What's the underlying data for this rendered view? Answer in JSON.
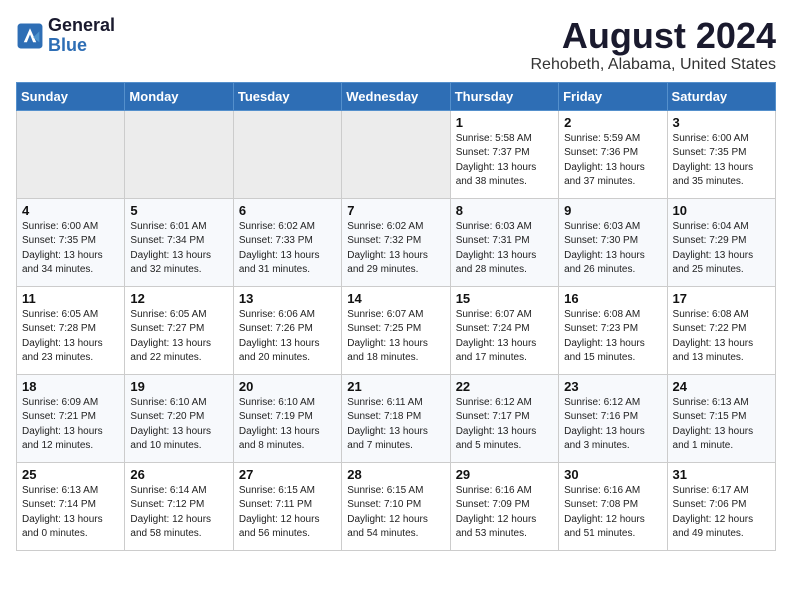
{
  "header": {
    "logo_line1": "General",
    "logo_line2": "Blue",
    "month_year": "August 2024",
    "location": "Rehobeth, Alabama, United States"
  },
  "weekdays": [
    "Sunday",
    "Monday",
    "Tuesday",
    "Wednesday",
    "Thursday",
    "Friday",
    "Saturday"
  ],
  "weeks": [
    [
      {
        "day": "",
        "info": ""
      },
      {
        "day": "",
        "info": ""
      },
      {
        "day": "",
        "info": ""
      },
      {
        "day": "",
        "info": ""
      },
      {
        "day": "1",
        "info": "Sunrise: 5:58 AM\nSunset: 7:37 PM\nDaylight: 13 hours\nand 38 minutes."
      },
      {
        "day": "2",
        "info": "Sunrise: 5:59 AM\nSunset: 7:36 PM\nDaylight: 13 hours\nand 37 minutes."
      },
      {
        "day": "3",
        "info": "Sunrise: 6:00 AM\nSunset: 7:35 PM\nDaylight: 13 hours\nand 35 minutes."
      }
    ],
    [
      {
        "day": "4",
        "info": "Sunrise: 6:00 AM\nSunset: 7:35 PM\nDaylight: 13 hours\nand 34 minutes."
      },
      {
        "day": "5",
        "info": "Sunrise: 6:01 AM\nSunset: 7:34 PM\nDaylight: 13 hours\nand 32 minutes."
      },
      {
        "day": "6",
        "info": "Sunrise: 6:02 AM\nSunset: 7:33 PM\nDaylight: 13 hours\nand 31 minutes."
      },
      {
        "day": "7",
        "info": "Sunrise: 6:02 AM\nSunset: 7:32 PM\nDaylight: 13 hours\nand 29 minutes."
      },
      {
        "day": "8",
        "info": "Sunrise: 6:03 AM\nSunset: 7:31 PM\nDaylight: 13 hours\nand 28 minutes."
      },
      {
        "day": "9",
        "info": "Sunrise: 6:03 AM\nSunset: 7:30 PM\nDaylight: 13 hours\nand 26 minutes."
      },
      {
        "day": "10",
        "info": "Sunrise: 6:04 AM\nSunset: 7:29 PM\nDaylight: 13 hours\nand 25 minutes."
      }
    ],
    [
      {
        "day": "11",
        "info": "Sunrise: 6:05 AM\nSunset: 7:28 PM\nDaylight: 13 hours\nand 23 minutes."
      },
      {
        "day": "12",
        "info": "Sunrise: 6:05 AM\nSunset: 7:27 PM\nDaylight: 13 hours\nand 22 minutes."
      },
      {
        "day": "13",
        "info": "Sunrise: 6:06 AM\nSunset: 7:26 PM\nDaylight: 13 hours\nand 20 minutes."
      },
      {
        "day": "14",
        "info": "Sunrise: 6:07 AM\nSunset: 7:25 PM\nDaylight: 13 hours\nand 18 minutes."
      },
      {
        "day": "15",
        "info": "Sunrise: 6:07 AM\nSunset: 7:24 PM\nDaylight: 13 hours\nand 17 minutes."
      },
      {
        "day": "16",
        "info": "Sunrise: 6:08 AM\nSunset: 7:23 PM\nDaylight: 13 hours\nand 15 minutes."
      },
      {
        "day": "17",
        "info": "Sunrise: 6:08 AM\nSunset: 7:22 PM\nDaylight: 13 hours\nand 13 minutes."
      }
    ],
    [
      {
        "day": "18",
        "info": "Sunrise: 6:09 AM\nSunset: 7:21 PM\nDaylight: 13 hours\nand 12 minutes."
      },
      {
        "day": "19",
        "info": "Sunrise: 6:10 AM\nSunset: 7:20 PM\nDaylight: 13 hours\nand 10 minutes."
      },
      {
        "day": "20",
        "info": "Sunrise: 6:10 AM\nSunset: 7:19 PM\nDaylight: 13 hours\nand 8 minutes."
      },
      {
        "day": "21",
        "info": "Sunrise: 6:11 AM\nSunset: 7:18 PM\nDaylight: 13 hours\nand 7 minutes."
      },
      {
        "day": "22",
        "info": "Sunrise: 6:12 AM\nSunset: 7:17 PM\nDaylight: 13 hours\nand 5 minutes."
      },
      {
        "day": "23",
        "info": "Sunrise: 6:12 AM\nSunset: 7:16 PM\nDaylight: 13 hours\nand 3 minutes."
      },
      {
        "day": "24",
        "info": "Sunrise: 6:13 AM\nSunset: 7:15 PM\nDaylight: 13 hours\nand 1 minute."
      }
    ],
    [
      {
        "day": "25",
        "info": "Sunrise: 6:13 AM\nSunset: 7:14 PM\nDaylight: 13 hours\nand 0 minutes."
      },
      {
        "day": "26",
        "info": "Sunrise: 6:14 AM\nSunset: 7:12 PM\nDaylight: 12 hours\nand 58 minutes."
      },
      {
        "day": "27",
        "info": "Sunrise: 6:15 AM\nSunset: 7:11 PM\nDaylight: 12 hours\nand 56 minutes."
      },
      {
        "day": "28",
        "info": "Sunrise: 6:15 AM\nSunset: 7:10 PM\nDaylight: 12 hours\nand 54 minutes."
      },
      {
        "day": "29",
        "info": "Sunrise: 6:16 AM\nSunset: 7:09 PM\nDaylight: 12 hours\nand 53 minutes."
      },
      {
        "day": "30",
        "info": "Sunrise: 6:16 AM\nSunset: 7:08 PM\nDaylight: 12 hours\nand 51 minutes."
      },
      {
        "day": "31",
        "info": "Sunrise: 6:17 AM\nSunset: 7:06 PM\nDaylight: 12 hours\nand 49 minutes."
      }
    ]
  ]
}
